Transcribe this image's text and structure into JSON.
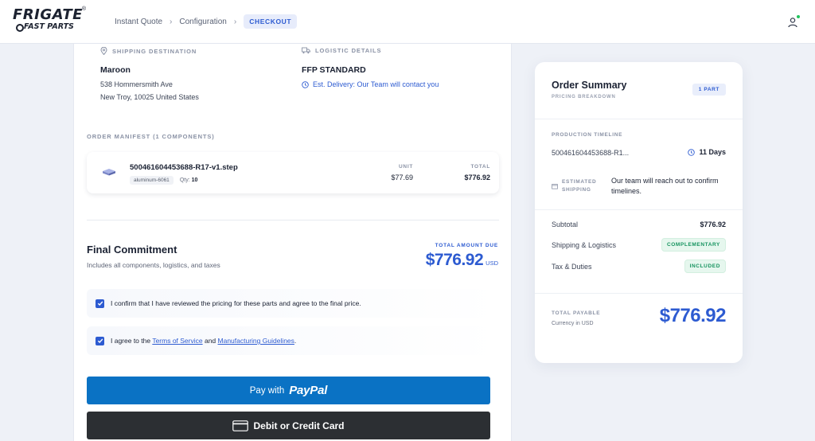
{
  "header": {
    "logo_top": "FRIGATE",
    "logo_bottom": "FAST PARTS",
    "logo_reg": "®",
    "breadcrumb": [
      {
        "label": "Instant Quote"
      },
      {
        "label": "Configuration"
      },
      {
        "label": "CHECKOUT"
      }
    ]
  },
  "shipping": {
    "label": "SHIPPING DESTINATION",
    "name": "Maroon",
    "address_line1": "538 Hommersmith Ave",
    "address_line2": "New Troy, 10025 United States"
  },
  "logistics": {
    "label": "LOGISTIC DETAILS",
    "method": "FFP STANDARD",
    "delivery": "Est. Delivery: Our Team will contact you"
  },
  "manifest": {
    "label": "ORDER MANIFEST (1 COMPONENTS)",
    "item": {
      "name": "500461604453688-R17-v1.step",
      "material": "aluminum-6061",
      "qty_label": "Qty:",
      "qty": "10",
      "unit_label": "UNIT",
      "unit_price": "$77.69",
      "total_label": "TOTAL",
      "total_price": "$776.92"
    }
  },
  "final": {
    "title": "Final Commitment",
    "subtitle": "Includes all components, logistics, and taxes",
    "total_label": "TOTAL AMOUNT DUE",
    "total": "$776.92",
    "currency": "USD"
  },
  "consents": {
    "pricing": "I confirm that I have reviewed the pricing for these parts and agree to the final price.",
    "terms_pre": "I agree to the ",
    "terms_link": "Terms of Service",
    "terms_mid": " and ",
    "guidelines_link": "Manufacturing Guidelines",
    "terms_post": "."
  },
  "payment": {
    "paypal_pre": "Pay with",
    "paypal_brand": "PayPal",
    "card_label": "Debit or Credit Card"
  },
  "summary": {
    "title": "Order Summary",
    "subtitle": "PRICING BREAKDOWN",
    "badge": "1 PART",
    "timeline_label": "PRODUCTION TIMELINE",
    "timeline_part": "500461604453688-R1...",
    "timeline_days": "11 Days",
    "est_label_1": "ESTIMATED",
    "est_label_2": "SHIPPING",
    "est_text": "Our team will reach out to confirm timelines.",
    "subtotal_label": "Subtotal",
    "subtotal": "$776.92",
    "shipping_label": "Shipping & Logistics",
    "shipping_value": "COMPLEMENTARY",
    "tax_label": "Tax & Duties",
    "tax_value": "INCLUDED",
    "payable_label": "TOTAL PAYABLE",
    "payable_sub": "Currency in USD",
    "payable": "$776.92"
  },
  "colors": {
    "accent": "#2d5bd1",
    "paypal": "#0a72c4",
    "card": "#2c2f33",
    "success": "#15935e"
  },
  "icons": [
    "location-pin-icon",
    "truck-icon",
    "clock-icon",
    "part-thumbnail-icon",
    "checkbox-checked-icon",
    "credit-card-icon",
    "user-icon",
    "box-icon"
  ]
}
